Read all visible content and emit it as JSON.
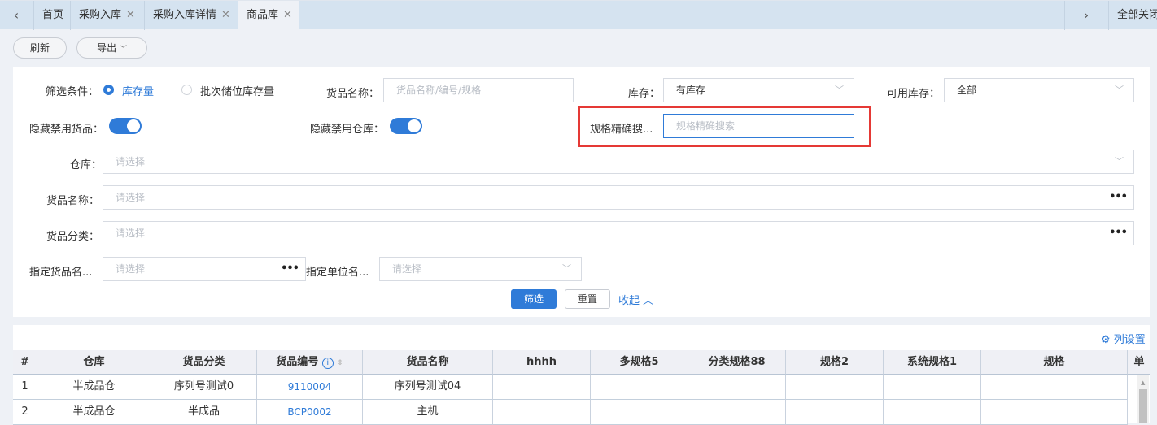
{
  "tabs": {
    "items": [
      {
        "label": "首页",
        "closable": false
      },
      {
        "label": "采购入库",
        "closable": true
      },
      {
        "label": "采购入库详情",
        "closable": true
      },
      {
        "label": "商品库",
        "closable": true,
        "active": true
      }
    ],
    "close_all": "全部关闭",
    "close_glyph": "✕"
  },
  "toolbar": {
    "refresh": "刷新",
    "export": "导出"
  },
  "filters": {
    "condition_label": "筛选条件：",
    "radio_stock": "库存量",
    "radio_batch": "批次储位库存量",
    "goods_name_label": "货品名称：",
    "goods_name_placeholder": "货品名称/编号/规格",
    "stock_label": "库存：",
    "stock_value": "有库存",
    "available_label": "可用库存：",
    "available_value": "全部",
    "hide_disabled_goods": "隐藏禁用货品：",
    "hide_disabled_goods_on": true,
    "hide_disabled_wh": "隐藏禁用仓库：",
    "hide_disabled_wh_on": true,
    "spec_label": "规格精确搜...",
    "spec_placeholder": "规格精确搜索",
    "warehouse_label": "仓库：",
    "warehouse_placeholder": "请选择",
    "goods_name2_label": "货品名称：",
    "goods_name2_placeholder": "请选择",
    "category_label": "货品分类：",
    "category_placeholder": "请选择",
    "assign_goods_label": "指定货品名...",
    "assign_goods_placeholder": "请选择",
    "assign_unit_label": "指定单位名...",
    "assign_unit_placeholder": "请选择",
    "filter_btn": "筛选",
    "reset_btn": "重置",
    "collapse": "收起"
  },
  "colors": {
    "accent": "#2f7bd8",
    "highlight_box": "#e53935"
  },
  "table": {
    "column_settings": "列设置",
    "columns": [
      "#",
      "仓库",
      "货品分类",
      "货品编号",
      "货品名称",
      "hhhh",
      "多规格5",
      "分类规格88",
      "规格2",
      "系统规格1",
      "规格",
      "单"
    ],
    "rows": [
      [
        "1",
        "半成品仓",
        "序列号测试0",
        "9110004",
        "序列号测试04",
        "",
        "",
        "",
        "",
        "",
        "",
        ""
      ],
      [
        "2",
        "半成品仓",
        "半成品",
        "BCP0002",
        "主机",
        "",
        "",
        "",
        "",
        "",
        "",
        ""
      ]
    ]
  }
}
